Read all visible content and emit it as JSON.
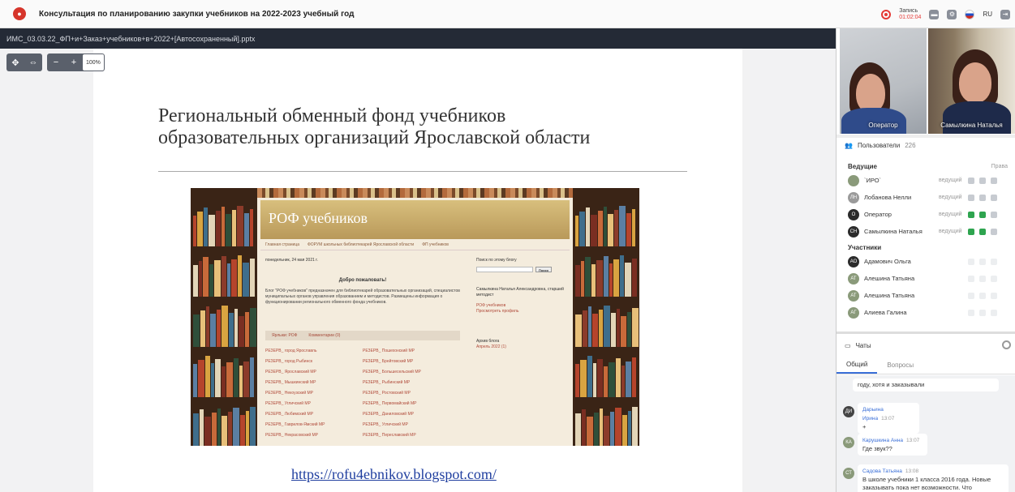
{
  "topbar": {
    "title": "Консультация по планированию закупки учебников на 2022-2023 учебный год",
    "record_label": "Запись",
    "record_time": "01:02:04",
    "lang": "RU"
  },
  "presentation": {
    "filename": "ИМС_03.03.22_ФП+и+Заказ+учебников+в+2022+[Автосохраненный].pptx",
    "zoom": "100%",
    "slide_title_line1": "Региональный обменный фонд учебников",
    "slide_title_line2": "образовательных организаций Ярославской области",
    "slide_link": "https://rofu4ebnikov.blogspot.com/",
    "blog": {
      "title": "РОФ учебников",
      "tabs": [
        "Главная страница",
        "ФОРУМ школьных библиотекарей Ярославской области",
        "ФП учебников"
      ],
      "date": "понедельник, 24 мая 2021 г.",
      "welcome": "Добро пожаловать!",
      "intro": "Блог \"РОФ учебников\" предназначен для библиотекарей образовательных организаций, специалистов муниципальных органов управления образованием и методистов. Размещены информация о функционировании регионального обменного фонда учебников.",
      "share_labels": [
        "Ярлыки: РОФ",
        "Комментарии (0)"
      ],
      "links_left": [
        "РЕЗЕРВ_ город Ярославль",
        "РЕЗЕРВ_ город Рыбинск",
        "РЕЗЕРВ_ Ярославский МР",
        "РЕЗЕРВ_ Мышкинский МР",
        "РЕЗЕРВ_ Некоузский МР",
        "РЕЗЕРВ_ Угличский МР",
        "РЕЗЕРВ_ Любимский МР",
        "РЕЗЕРВ_ Гаврилов-Ямский МР",
        "РЕЗЕРВ_ Некрасовский МР"
      ],
      "links_right": [
        "РЕЗЕРВ_ Пошехонский МР",
        "РЕЗЕРВ_ Брейтовский МР",
        "РЕЗЕРВ_ Большесельский МР",
        "РЕЗЕРВ_ Рыбинский МР",
        "РЕЗЕРВ_ Ростовский МР",
        "РЕЗЕРВ_ Первомайский МР",
        "РЕЗЕРВ_ Даниловский МР",
        "РЕЗЕРВ_ Угличский МР",
        "РЕЗЕРВ_ Переславский МР"
      ],
      "side_search": "Поиск по этому блогу",
      "side_search_button": "Поиск",
      "side_author": "Самылкина Наталья Александровна, старший методист",
      "side_profile": "РОФ учебников",
      "side_profile_link": "Просмотреть профиль",
      "side_archive": "Архив блога",
      "side_archive_item": "Апрель 2022 (1)"
    }
  },
  "videos": [
    {
      "label": "Оператор"
    },
    {
      "label": "Самылкина Наталья"
    }
  ],
  "users": {
    "title": "Пользователи",
    "count": "226",
    "hosts_title": "Ведущие",
    "rights_label": "Права",
    "hosts": [
      {
        "initials": "",
        "name": "`ИРО`",
        "role": "ведущий",
        "color": "#8a9a7a"
      },
      {
        "initials": "ЛН",
        "name": "Лобанова Нелли",
        "role": "ведущий",
        "color": "#9a9a9a"
      },
      {
        "initials": "О",
        "name": "Оператор",
        "role": "ведущий",
        "color": "#2b2b2b"
      },
      {
        "initials": "СН",
        "name": "Самылкина Наталья",
        "role": "ведущий",
        "color": "#2b2b2b"
      }
    ],
    "participants_title": "Участники",
    "participants": [
      {
        "initials": "АО",
        "name": "Адамович Ольга",
        "color": "#2b2b2b"
      },
      {
        "initials": "АТ",
        "name": "Алешина Татьяна",
        "color": "#8a9a7a"
      },
      {
        "initials": "АТ",
        "name": "Алешина Татьяна",
        "color": "#8a9a7a"
      },
      {
        "initials": "АГ",
        "name": "Алиева Галина",
        "color": "#8a9a7a"
      }
    ]
  },
  "chat": {
    "title": "Чаты",
    "tabs": [
      "Общий",
      "Вопросы"
    ],
    "messages": [
      {
        "initials": "",
        "author": "",
        "time": "",
        "text": "году, хотя и заказывали"
      },
      {
        "initials": "ДИ",
        "author": "Дарьина Ирина",
        "time": "13:07",
        "text": "+",
        "color": "#444"
      },
      {
        "initials": "КА",
        "author": "Карушкина Анна",
        "time": "13:07",
        "text": "Где звук??",
        "color": "#8a9a7a"
      },
      {
        "initials": "СТ",
        "author": "Садова Татьяна",
        "time": "13:08",
        "text": "В школе учебники 1 класса 2016 года. Новые заказывать пока нет возможности. Что",
        "color": "#8a9a7a"
      }
    ]
  }
}
